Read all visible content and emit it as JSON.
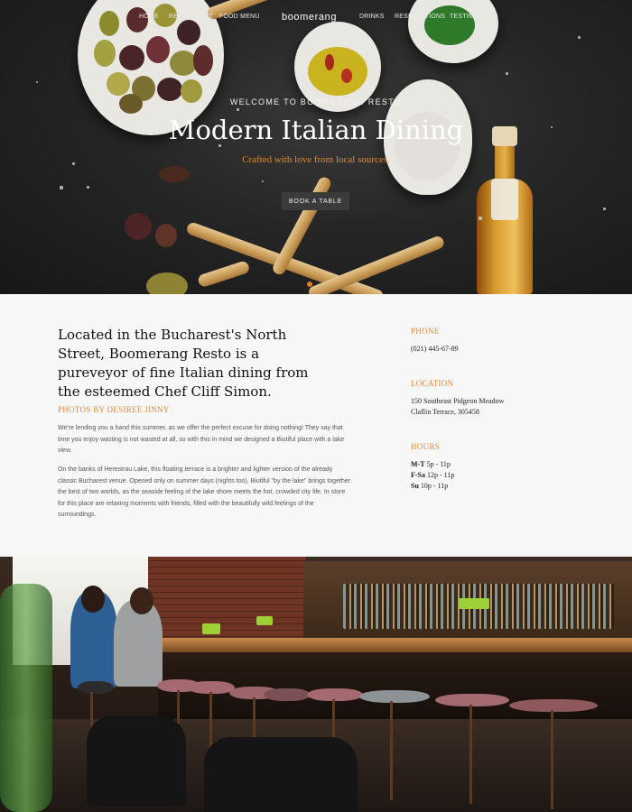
{
  "nav": {
    "brand": "boomerang",
    "left_links": [
      "HOME",
      "RESTAURANT",
      "FOOD MENU"
    ],
    "right_links": [
      "DRINKS",
      "RESERVATIONS",
      "TESTIMONIALS"
    ]
  },
  "hero": {
    "subtitle": "WELCOME TO BOOMERANG RESTO",
    "title": "Modern Italian Dining",
    "tagline": "Crafted with love from local sources.",
    "cta_label": "BOOK A TABLE"
  },
  "about": {
    "lead": "Located in the Bucharest's North Street, Boomerang Resto is a pureveyor of fine Italian dining from the esteemed Chef Cliff Simon.",
    "photo_credit": "PHOTOS BY DESIREE JINNY",
    "paragraphs": [
      "We're lending you a hand this summer, as we offer the perfect excuse for doing nothing! They say that time you enjoy wasting is not wasted at all, so with this in mind we designed a Biutiful place with a lake view.",
      "On the banks of Herestrau Lake, this floating terrace is a brighter and lighter version of the already classic Bucharest venue. Opened only on summer days (nights too), Biutiful \"by the lake\" brings together the best of two worlds, as the seaside feeling of the lake shore meets the hot, crowded city life. In store for this place are relaxing moments with friends, filled with the beautifully wild feelings of the surroundings."
    ]
  },
  "contact": {
    "phone_label": "PHONE",
    "phone": "(021) 445-67-89",
    "location_label": "LOCATION",
    "address_line1": "150 Southeast Pidgeon Meadow",
    "address_line2": "Claflin Terrace, 305458",
    "hours_label": "HOURS",
    "hours": [
      {
        "days": "M-T",
        "time": "5p - 11p"
      },
      {
        "days": "F-Sa",
        "time": "12p - 11p"
      },
      {
        "days": "Su",
        "time": "10p - 11p"
      }
    ]
  },
  "colors": {
    "accent": "#e0883a",
    "dark": "#1e1e1e",
    "background": "#f7f7f7"
  }
}
